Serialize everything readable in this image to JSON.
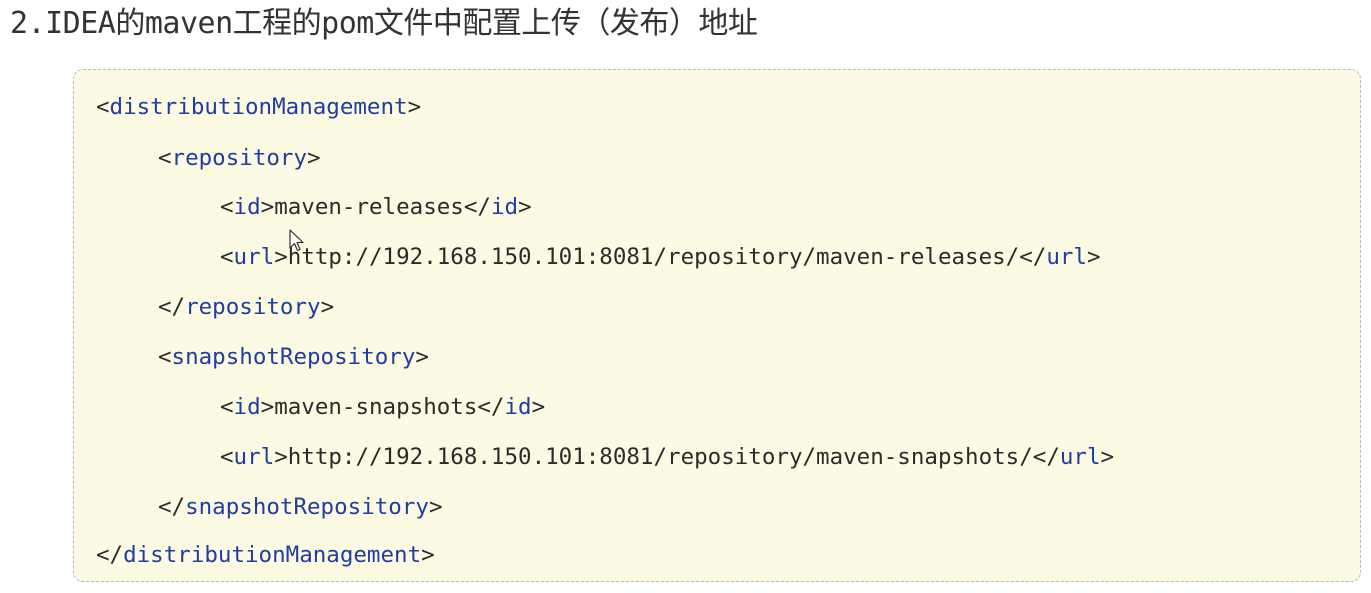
{
  "heading": "2.IDEA的maven工程的pom文件中配置上传（发布）地址",
  "code_lines": [
    {
      "indent": "",
      "parts": [
        {
          "t": "<",
          "k": "punct"
        },
        {
          "t": "distributionManagement",
          "k": "tag"
        },
        {
          "t": ">",
          "k": "punct"
        }
      ]
    },
    {
      "indent": "    ",
      "parts": [
        {
          "t": "<",
          "k": "punct"
        },
        {
          "t": "repository",
          "k": "tag"
        },
        {
          "t": ">",
          "k": "punct"
        }
      ]
    },
    {
      "indent": "        ",
      "parts": [
        {
          "t": "<",
          "k": "punct"
        },
        {
          "t": "id",
          "k": "tag"
        },
        {
          "t": ">",
          "k": "punct"
        },
        {
          "t": "maven-releases",
          "k": "text"
        },
        {
          "t": "</",
          "k": "punct"
        },
        {
          "t": "id",
          "k": "tag"
        },
        {
          "t": ">",
          "k": "punct"
        }
      ]
    },
    {
      "indent": "        ",
      "parts": [
        {
          "t": "<",
          "k": "punct"
        },
        {
          "t": "url",
          "k": "tag"
        },
        {
          "t": ">",
          "k": "punct"
        },
        {
          "t": "http://192.168.150.101:8081/repository/maven-releases/",
          "k": "text"
        },
        {
          "t": "</",
          "k": "punct"
        },
        {
          "t": "url",
          "k": "tag"
        },
        {
          "t": ">",
          "k": "punct"
        }
      ]
    },
    {
      "indent": "    ",
      "parts": [
        {
          "t": "</",
          "k": "punct"
        },
        {
          "t": "repository",
          "k": "tag"
        },
        {
          "t": ">",
          "k": "punct"
        }
      ]
    },
    {
      "indent": "    ",
      "parts": [
        {
          "t": "<",
          "k": "punct"
        },
        {
          "t": "snapshotRepository",
          "k": "tag"
        },
        {
          "t": ">",
          "k": "punct"
        }
      ]
    },
    {
      "indent": "        ",
      "parts": [
        {
          "t": "<",
          "k": "punct"
        },
        {
          "t": "id",
          "k": "tag"
        },
        {
          "t": ">",
          "k": "punct"
        },
        {
          "t": "maven-snapshots",
          "k": "text"
        },
        {
          "t": "</",
          "k": "punct"
        },
        {
          "t": "id",
          "k": "tag"
        },
        {
          "t": ">",
          "k": "punct"
        }
      ]
    },
    {
      "indent": "        ",
      "parts": [
        {
          "t": "<",
          "k": "punct"
        },
        {
          "t": "url",
          "k": "tag"
        },
        {
          "t": ">",
          "k": "punct"
        },
        {
          "t": "http://192.168.150.101:8081/repository/maven-snapshots/",
          "k": "text"
        },
        {
          "t": "</",
          "k": "punct"
        },
        {
          "t": "url",
          "k": "tag"
        },
        {
          "t": ">",
          "k": "punct"
        }
      ]
    },
    {
      "indent": "    ",
      "parts": [
        {
          "t": "</",
          "k": "punct"
        },
        {
          "t": "snapshotRepository",
          "k": "tag"
        },
        {
          "t": ">",
          "k": "punct"
        }
      ]
    },
    {
      "indent": "",
      "parts": [
        {
          "t": "</",
          "k": "punct"
        },
        {
          "t": "distributionManagement",
          "k": "tag"
        },
        {
          "t": ">",
          "k": "punct"
        }
      ]
    }
  ],
  "colors": {
    "tag": "#1f3ea0",
    "text": "#2b2b2b",
    "box_background": "#fcfae3",
    "box_border": "#b9b9b9"
  },
  "icons": {
    "cursor": "mouse-pointer-icon"
  }
}
